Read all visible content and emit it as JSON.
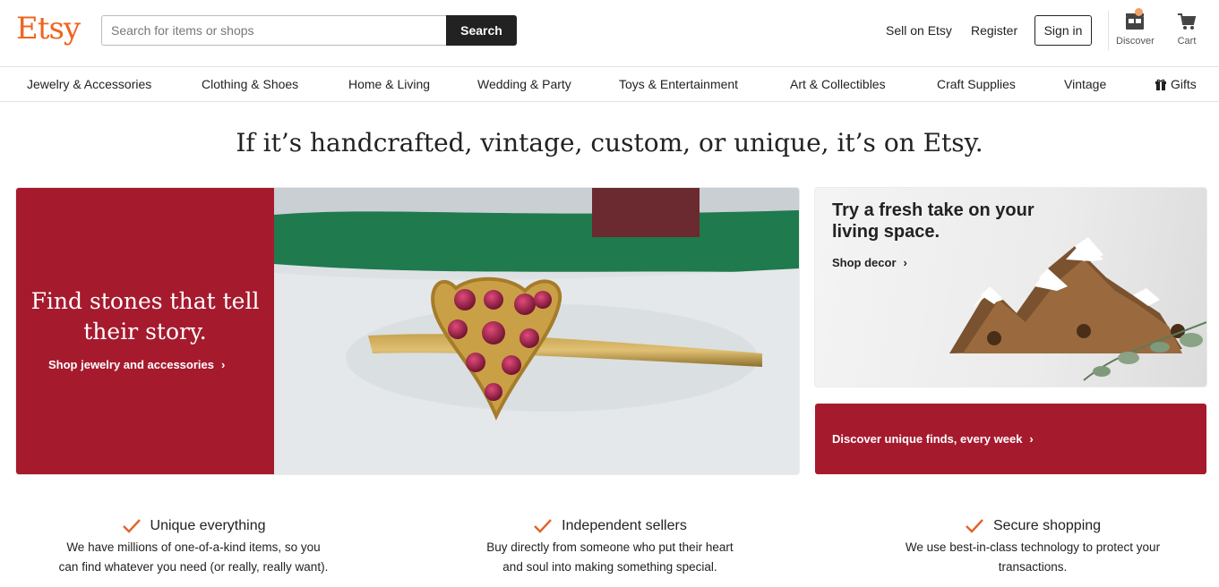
{
  "header": {
    "logo": "Etsy",
    "search_placeholder": "Search for items or shops",
    "search_button": "Search",
    "sell_link": "Sell on Etsy",
    "register_link": "Register",
    "signin_button": "Sign in",
    "discover_label": "Discover",
    "cart_label": "Cart"
  },
  "categories": [
    "Jewelry & Accessories",
    "Clothing & Shoes",
    "Home & Living",
    "Wedding & Party",
    "Toys & Entertainment",
    "Art & Collectibles",
    "Craft Supplies",
    "Vintage",
    "Gifts"
  ],
  "headline": "If it’s handcrafted, vintage, custom, or unique, it’s on Etsy.",
  "hero": {
    "title": "Find stones that tell their story.",
    "link": "Shop jewelry and accessories"
  },
  "decor_card": {
    "title": "Try a fresh take on your living space.",
    "link": "Shop decor"
  },
  "discover_card": {
    "link": "Discover unique finds, every week"
  },
  "values": [
    {
      "title": "Unique everything",
      "line1": "We have millions of one-of-a-kind items, so you",
      "line2": "can find whatever you need (or really, really want)."
    },
    {
      "title": "Independent sellers",
      "line1": "Buy directly from someone who put their heart",
      "line2": "and soul into making something special."
    },
    {
      "title": "Secure shopping",
      "line1": "We use best-in-class technology to protect your",
      "line2": "transactions."
    }
  ],
  "colors": {
    "brand_orange": "#f1641e",
    "hero_red": "#a61a2e",
    "check_orange": "#e0652b"
  }
}
